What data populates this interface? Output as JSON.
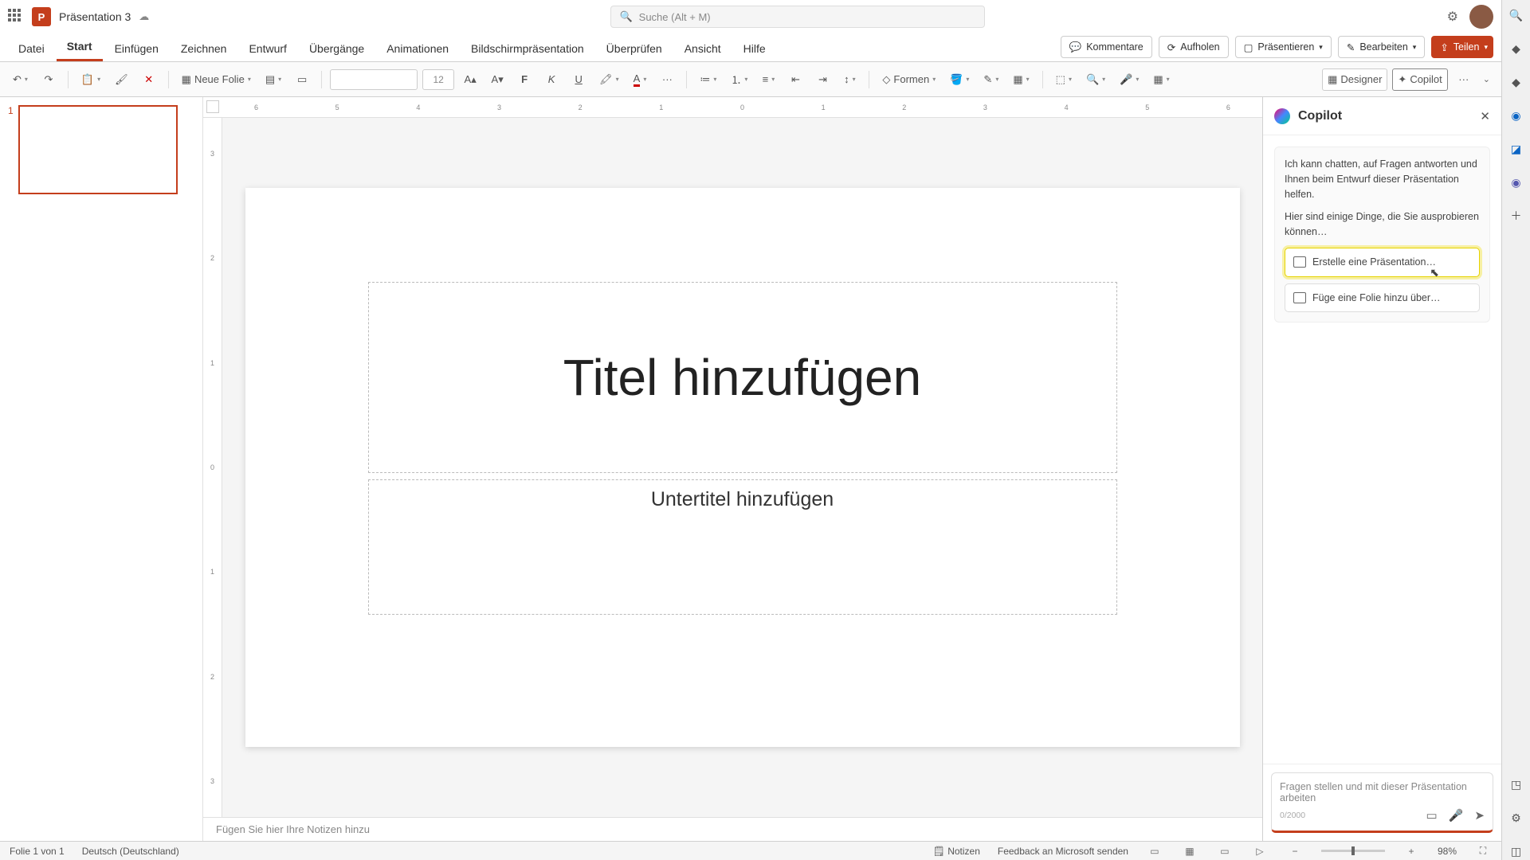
{
  "title_bar": {
    "doc_name": "Präsentation 3",
    "search_placeholder": "Suche (Alt + M)"
  },
  "tabs": {
    "datei": "Datei",
    "start": "Start",
    "einfuegen": "Einfügen",
    "zeichnen": "Zeichnen",
    "entwurf": "Entwurf",
    "uebergaenge": "Übergänge",
    "animationen": "Animationen",
    "bildschirm": "Bildschirmpräsentation",
    "ueberpruefen": "Überprüfen",
    "ansicht": "Ansicht",
    "hilfe": "Hilfe"
  },
  "ribbon_right": {
    "kommentare": "Kommentare",
    "aufholen": "Aufholen",
    "praesentieren": "Präsentieren",
    "bearbeiten": "Bearbeiten",
    "teilen": "Teilen"
  },
  "toolbar": {
    "neue_folie": "Neue Folie",
    "font_size": "12",
    "bold": "F",
    "italic": "K",
    "underline": "U",
    "formen": "Formen",
    "designer": "Designer",
    "copilot": "Copilot",
    "more": "···"
  },
  "ruler_h": [
    "6",
    "5",
    "4",
    "3",
    "2",
    "1",
    "0",
    "1",
    "2",
    "3",
    "4",
    "5",
    "6"
  ],
  "ruler_v": [
    "3",
    "2",
    "1",
    "0",
    "1",
    "2",
    "3"
  ],
  "slide": {
    "thumb_num": "1",
    "title_placeholder": "Titel hinzufügen",
    "subtitle_placeholder": "Untertitel hinzufügen"
  },
  "notes": {
    "placeholder": "Fügen Sie hier Ihre Notizen hinzu"
  },
  "copilot": {
    "title": "Copilot",
    "intro1": "Ich kann chatten, auf Fragen antworten und Ihnen beim Entwurf dieser Präsentation helfen.",
    "intro2": "Hier sind einige Dinge, die Sie ausprobieren können…",
    "sug1": "Erstelle eine Präsentation…",
    "sug2": "Füge eine Folie hinzu über…",
    "input_placeholder": "Fragen stellen und mit dieser Präsentation arbeiten",
    "char_count": "0/2000"
  },
  "status": {
    "slide": "Folie 1 von 1",
    "lang": "Deutsch (Deutschland)",
    "notizen": "Notizen",
    "feedback": "Feedback an Microsoft senden",
    "zoom": "98%"
  }
}
